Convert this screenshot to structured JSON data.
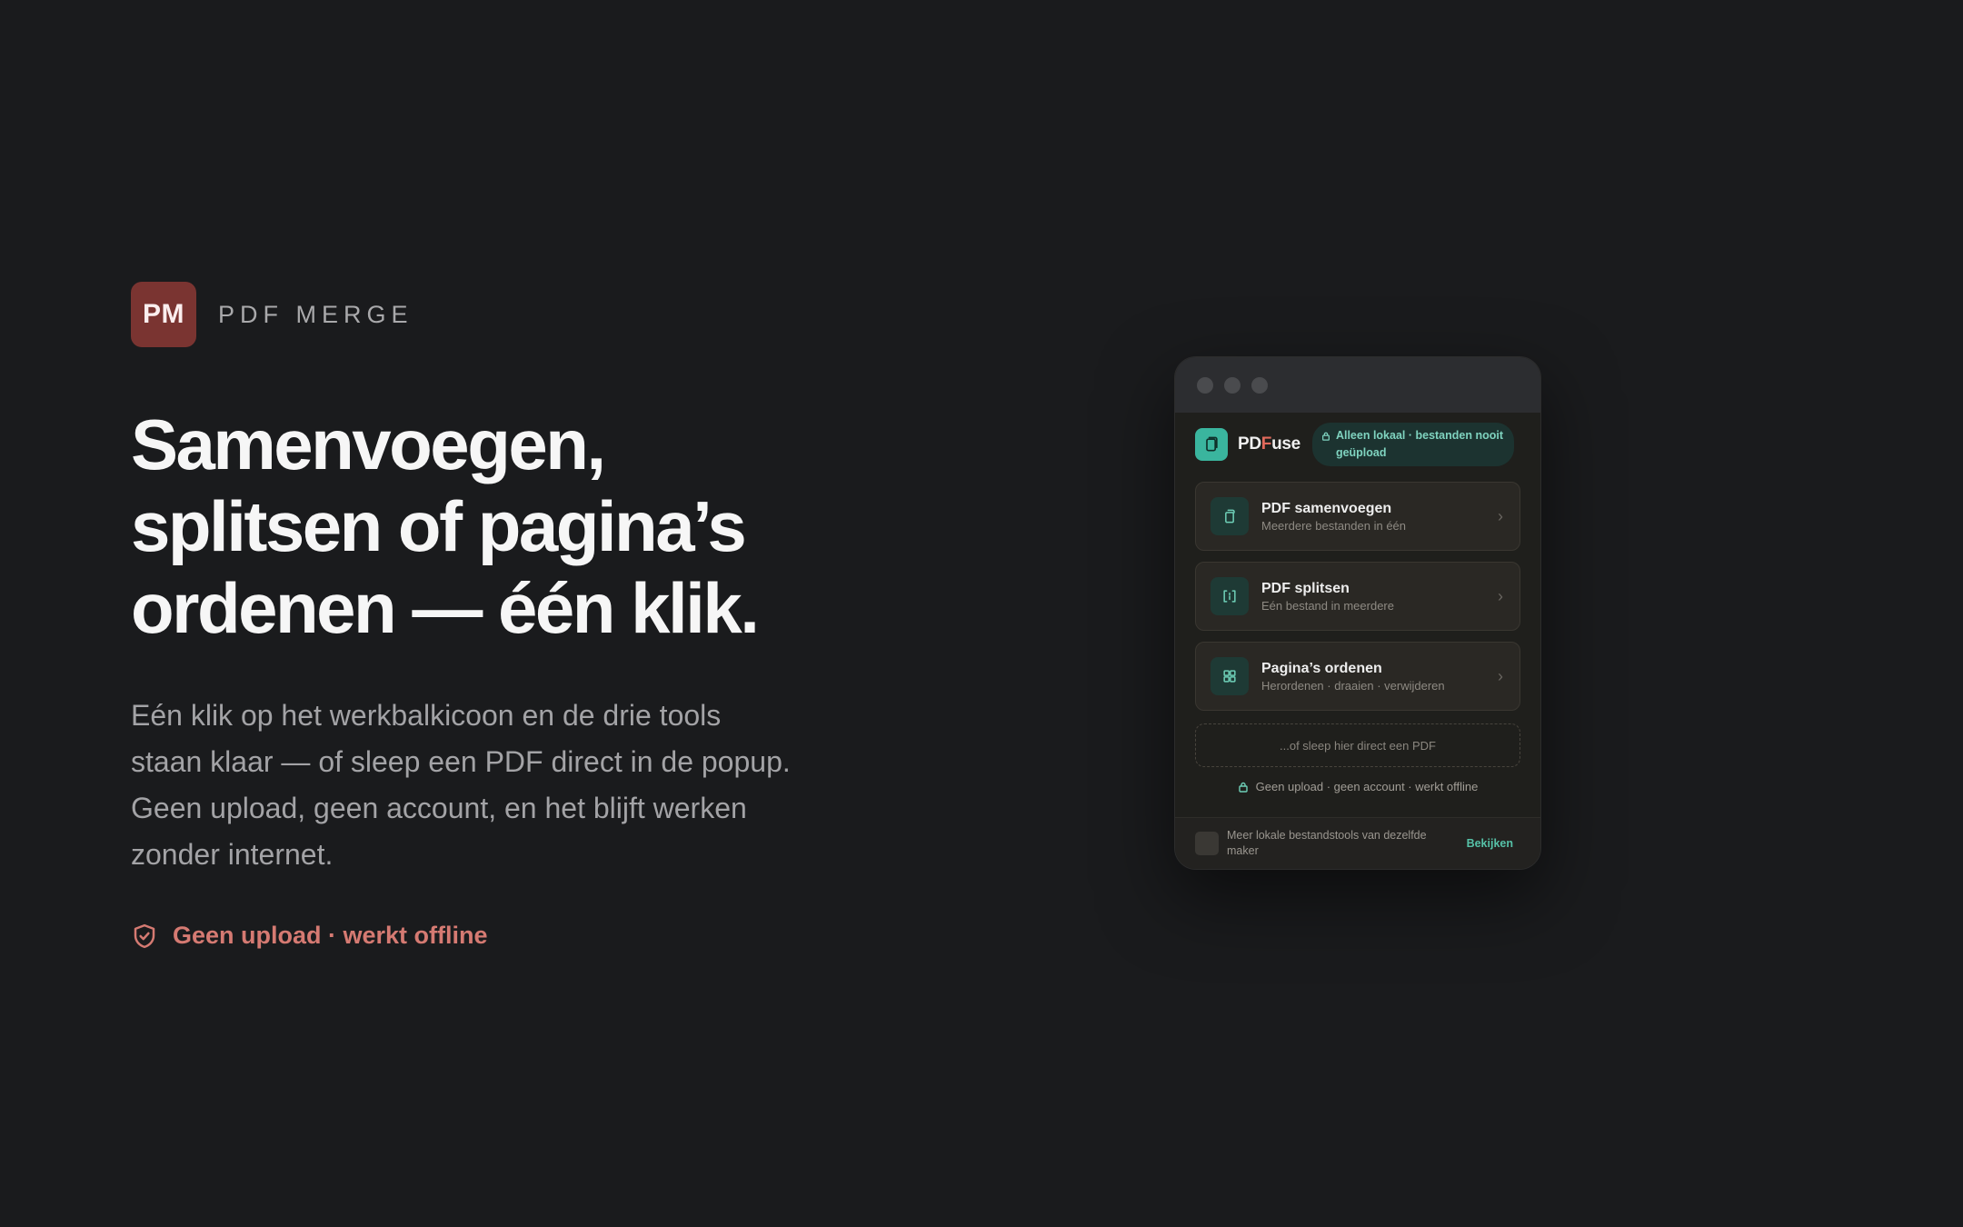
{
  "brand": {
    "logo_text": "PM",
    "name": "PDF MERGE"
  },
  "headline": {
    "lines": [
      "Samenvoegen,",
      "splitsen of pagina’s",
      "ordenen — één klik."
    ]
  },
  "description": {
    "lines": [
      "Eén klik op het werkbalkicoon en de drie tools",
      "staan klaar — of sleep een PDF direct in de popup.",
      "Geen upload, geen account, en het blijft werken",
      "zonder internet."
    ]
  },
  "badge": {
    "text": "Geen upload · werkt offline",
    "icon": "shield-check-icon",
    "color": "#d57a72"
  },
  "popup": {
    "app_name_prefix": "PD",
    "app_name_accent": "F",
    "app_name_suffix": "use",
    "privacy_pill": {
      "line1": "Alleen lokaal · bestanden nooit",
      "line2": "geüpload"
    },
    "tools": [
      {
        "title": "PDF samenvoegen",
        "subtitle": "Meerdere bestanden in één",
        "icon": "merge-icon"
      },
      {
        "title": "PDF splitsen",
        "subtitle": "Eén bestand in meerdere",
        "icon": "split-icon"
      },
      {
        "title": "Pagina’s ordenen",
        "subtitle": "Herordenen · draaien · verwijderen",
        "icon": "grid-icon"
      }
    ],
    "dropzone_text": "...of sleep hier direct een PDF",
    "offline_note": "Geen upload · geen account · werkt offline",
    "footer": {
      "line1": "Meer lokale bestandstools van dezelfde",
      "line2": "maker",
      "link": "Bekijken"
    }
  },
  "colors": {
    "background": "#1a1b1d",
    "brand": "#7a3431",
    "accent": "#3ab59e",
    "link": "#56c2a8"
  }
}
